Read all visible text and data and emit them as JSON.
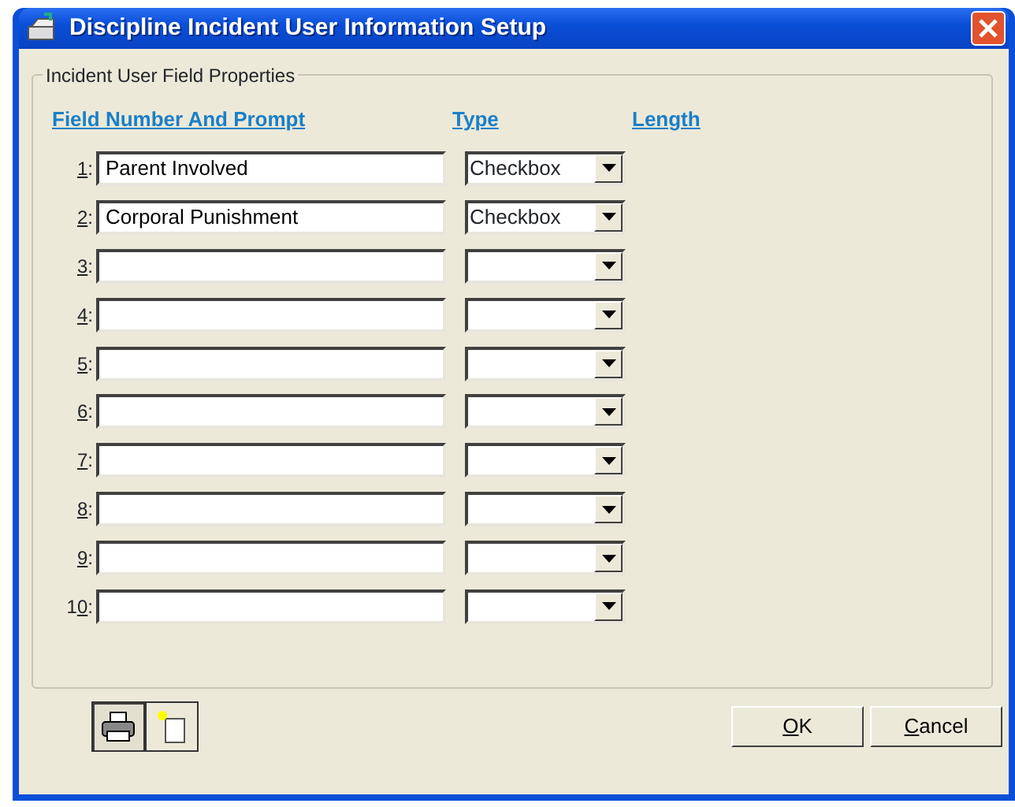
{
  "window": {
    "title": "Discipline Incident User Information Setup"
  },
  "group": {
    "title": "Incident User Field Properties"
  },
  "columns": [
    "Field Number And Prompt",
    "Type",
    "Length"
  ],
  "fields": [
    {
      "number": "1:",
      "prompt": "Parent Involved",
      "type": "Checkbox"
    },
    {
      "number": "2:",
      "prompt": "Corporal Punishment",
      "type": "Checkbox"
    },
    {
      "number": "3:"
    },
    {
      "number": "4:"
    },
    {
      "number": "5:"
    },
    {
      "number": "6:"
    },
    {
      "number": "7:"
    },
    {
      "number": "8:"
    },
    {
      "number": "9:"
    },
    {
      "number": "10:"
    }
  ],
  "tools": [
    {
      "kind": "print",
      "pressed": true
    },
    {
      "kind": "new",
      "pressed": false
    }
  ],
  "buttons": [
    "OK",
    "Cancel"
  ]
}
